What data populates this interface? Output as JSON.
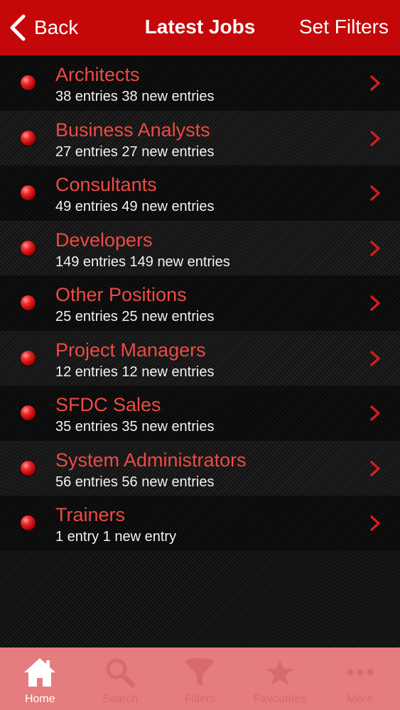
{
  "navbar": {
    "back_label": "Back",
    "title": "Latest Jobs",
    "right_label": "Set Filters"
  },
  "jobs": [
    {
      "title": "Architects",
      "subtitle": "38 entries 38 new entries"
    },
    {
      "title": "Business Analysts",
      "subtitle": "27 entries 27 new entries"
    },
    {
      "title": "Consultants",
      "subtitle": "49 entries 49 new entries"
    },
    {
      "title": "Developers",
      "subtitle": "149 entries 149 new entries"
    },
    {
      "title": "Other Positions",
      "subtitle": "25 entries 25 new entries"
    },
    {
      "title": "Project Managers",
      "subtitle": "12 entries 12 new entries"
    },
    {
      "title": "SFDC Sales",
      "subtitle": "35 entries 35 new entries"
    },
    {
      "title": "System Administrators",
      "subtitle": "56 entries 56 new entries"
    },
    {
      "title": "Trainers",
      "subtitle": "1 entry 1 new entry"
    }
  ],
  "tabs": [
    {
      "label": "Home",
      "icon": "home-icon",
      "active": true
    },
    {
      "label": "Search",
      "icon": "search-icon",
      "active": false
    },
    {
      "label": "Filters",
      "icon": "filter-icon",
      "active": false
    },
    {
      "label": "Favourites",
      "icon": "star-icon",
      "active": false
    },
    {
      "label": "More",
      "icon": "more-icon",
      "active": false
    }
  ],
  "colors": {
    "navbar": "#c4080a",
    "job_title": "#ee4a43",
    "tabbar": "#e57c7d"
  }
}
